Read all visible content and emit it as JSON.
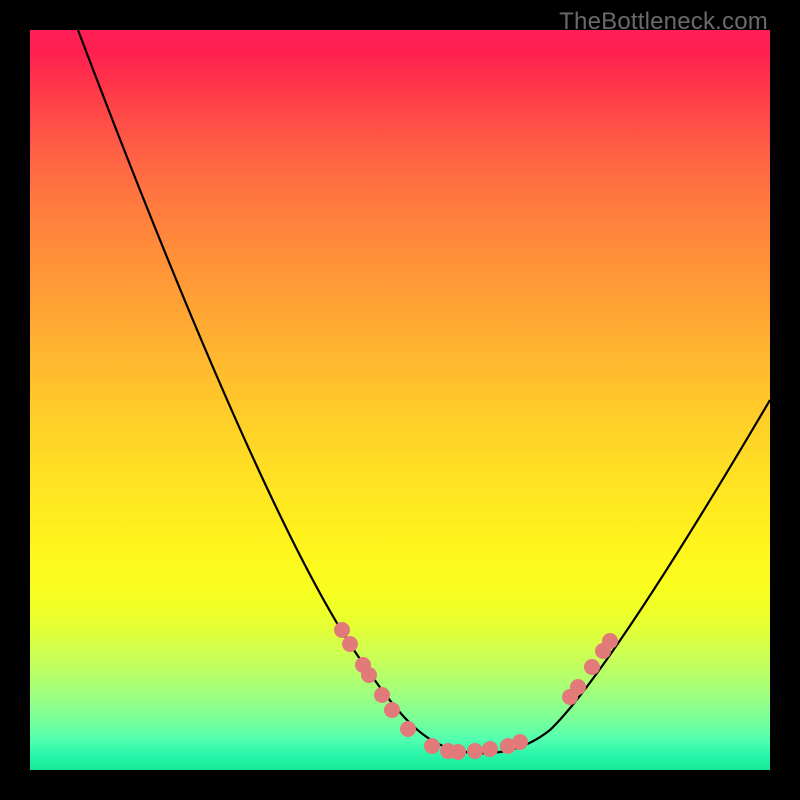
{
  "watermark": "TheBottleneck.com",
  "chart_data": {
    "type": "line",
    "title": "",
    "xlabel": "",
    "ylabel": "",
    "xlim": [
      0,
      100
    ],
    "ylim": [
      0,
      100
    ],
    "background_gradient": {
      "top": "#ff1f57",
      "mid": "#ffe522",
      "bottom": "#18e898"
    },
    "series": [
      {
        "name": "bottleneck-curve",
        "x": [
          6,
          15,
          25,
          35,
          42,
          48,
          53,
          57,
          62,
          68,
          75,
          82,
          90,
          100
        ],
        "y": [
          100,
          78,
          54,
          34,
          22,
          12,
          6,
          2,
          2,
          6,
          16,
          30,
          44,
          60
        ],
        "stroke": "#000000"
      }
    ],
    "markers": {
      "name": "highlighted-points",
      "color": "#e37a7a",
      "x": [
        42,
        43,
        45,
        46,
        48,
        49,
        51,
        54,
        56,
        58,
        60,
        62,
        64,
        66,
        73,
        74,
        76,
        77,
        78
      ],
      "y": [
        19,
        17,
        14,
        13,
        10,
        8,
        6,
        3,
        2.5,
        2.4,
        2.5,
        2.6,
        3,
        3.8,
        10,
        11,
        14,
        16,
        17
      ]
    }
  }
}
